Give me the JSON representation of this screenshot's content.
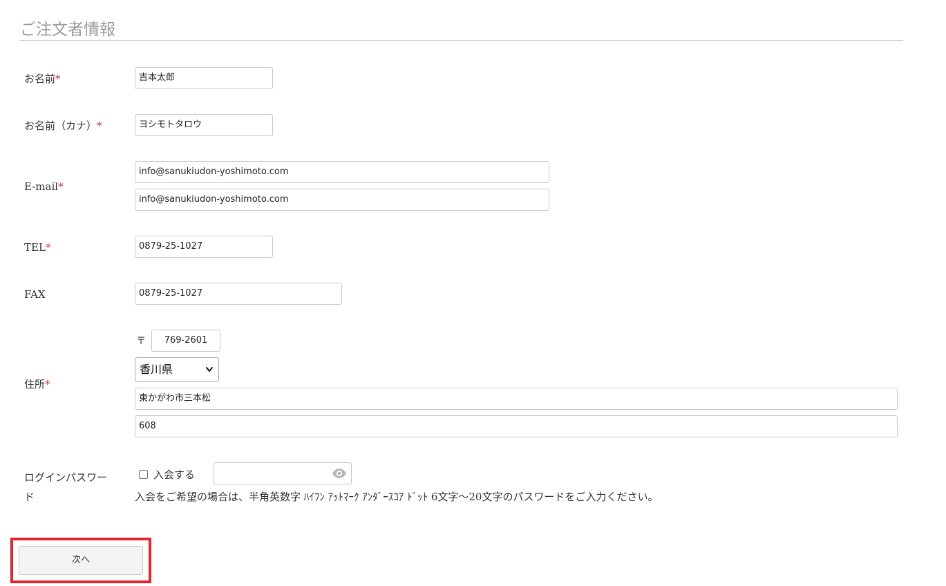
{
  "section": {
    "title": "ご注文者情報"
  },
  "required_mark": "*",
  "form": {
    "name": {
      "label": "お名前",
      "value": "吉本太郎"
    },
    "kana": {
      "label": "お名前（カナ）",
      "value": "ヨシモトタロウ"
    },
    "email": {
      "label": "E-mail",
      "value": "info@sanukiudon-yoshimoto.com",
      "confirm_value": "info@sanukiudon-yoshimoto.com"
    },
    "tel": {
      "label": "TEL",
      "value": "0879-25-1027"
    },
    "fax": {
      "label": "FAX",
      "value": "0879-25-1027"
    },
    "address": {
      "label": "住所",
      "zip_mark": "〒",
      "zip": "769-2601",
      "prefecture": "香川県",
      "line1": "東かがわ市三本松",
      "line2": "608"
    },
    "password": {
      "label_line1": "ログインパスワー",
      "label_line2": "ド",
      "join_label": "入会する",
      "join_checked": false,
      "help": "入会をご希望の場合は、半角英数字 ﾊｲﾌﾝ ｱｯﾄﾏｰｸ ｱﾝﾀﾞｰｽｺｱ ﾄﾞｯﾄ 6文字～20文字のパスワードをご入力ください。"
    }
  },
  "actions": {
    "next_label": "次へ"
  },
  "colors": {
    "required": "#d2322d",
    "highlight": "#e3262c",
    "title": "#9a9a9a"
  },
  "icons": {
    "password_toggle": "eye-icon",
    "select_arrow": "chevron-down-icon"
  }
}
